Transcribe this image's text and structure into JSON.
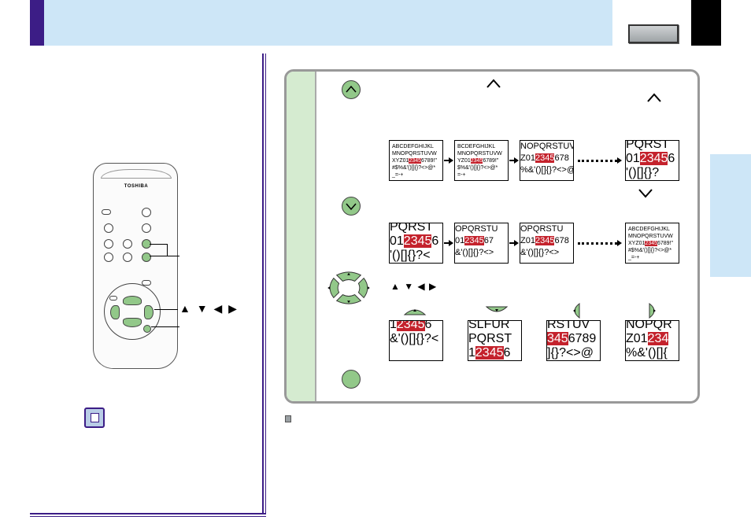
{
  "remote": {
    "brand": "TOSHIBA"
  },
  "labels": {
    "arrow_keys": "▲ ▼ ◀ ▶",
    "panel_arrow_keys": "▲ ▼ ◀ ▶"
  },
  "frames": {
    "row1": [
      {
        "lines": [
          "ABCDEFGHIJKL",
          "MNOPQRSTUVW",
          "XYZ01|2345|6789!\"",
          "#$%&'()[]{}?<>@*",
          "_=-+"
        ],
        "style": "tiny"
      },
      {
        "lines": [
          "BCDEFGHIJKL",
          "MNOPQRSTUVW",
          "YZ01|2345|6789!\"",
          "$%&'()[]{}?<>@*",
          "=-+"
        ],
        "style": "tiny"
      },
      {
        "lines": [
          "NOPQRSTUVW",
          "Z01|2345|678",
          "%&'()[]{}?<>@"
        ],
        "style": "mid"
      },
      {
        "lines": [
          "PQRST",
          "01|2345|6",
          "'()[]{}?"
        ],
        "style": "big"
      }
    ],
    "row2": [
      {
        "lines": [
          "PQRST",
          "01|2345|6",
          "'()[]{}?<"
        ],
        "style": "big"
      },
      {
        "lines": [
          "OPQRSTU",
          "01|2345|67",
          "&'()[]{}?<>"
        ],
        "style": "mid"
      },
      {
        "lines": [
          "OPQRSTU",
          "Z01|2345|678",
          "&'()[]{}?<>"
        ],
        "style": "mid"
      },
      {
        "lines": [
          "ABCDEFGHIJKL",
          "MNOPQRSTUVW",
          "XYZ01|2345|6789!\"",
          "#$%&'()[]{}?<>@*",
          "_=-+"
        ],
        "style": "tiny"
      }
    ],
    "row3": [
      {
        "lines": [
          "1|2345|6",
          "&'()[]{}?<"
        ],
        "style": "big"
      },
      {
        "lines": [
          "SLFUR",
          "PQRST",
          "1|2345|6"
        ],
        "style": "big"
      },
      {
        "lines": [
          "RSTUV",
          "|345|6789",
          "]{}?<>@"
        ],
        "style": "big"
      },
      {
        "lines": [
          "NOPQR",
          "Z01|234|",
          "%&'()[]{"
        ],
        "style": "big"
      }
    ]
  },
  "colors": {
    "accent": "#3c1d86",
    "header_band": "#cde6f7",
    "green_button": "#92c889",
    "panel_strip": "#d5ebd0",
    "highlight": "#c4222c"
  },
  "icons": [
    "up-button-icon",
    "down-button-icon",
    "dpad-icon",
    "enter-button-icon",
    "note-icon"
  ]
}
